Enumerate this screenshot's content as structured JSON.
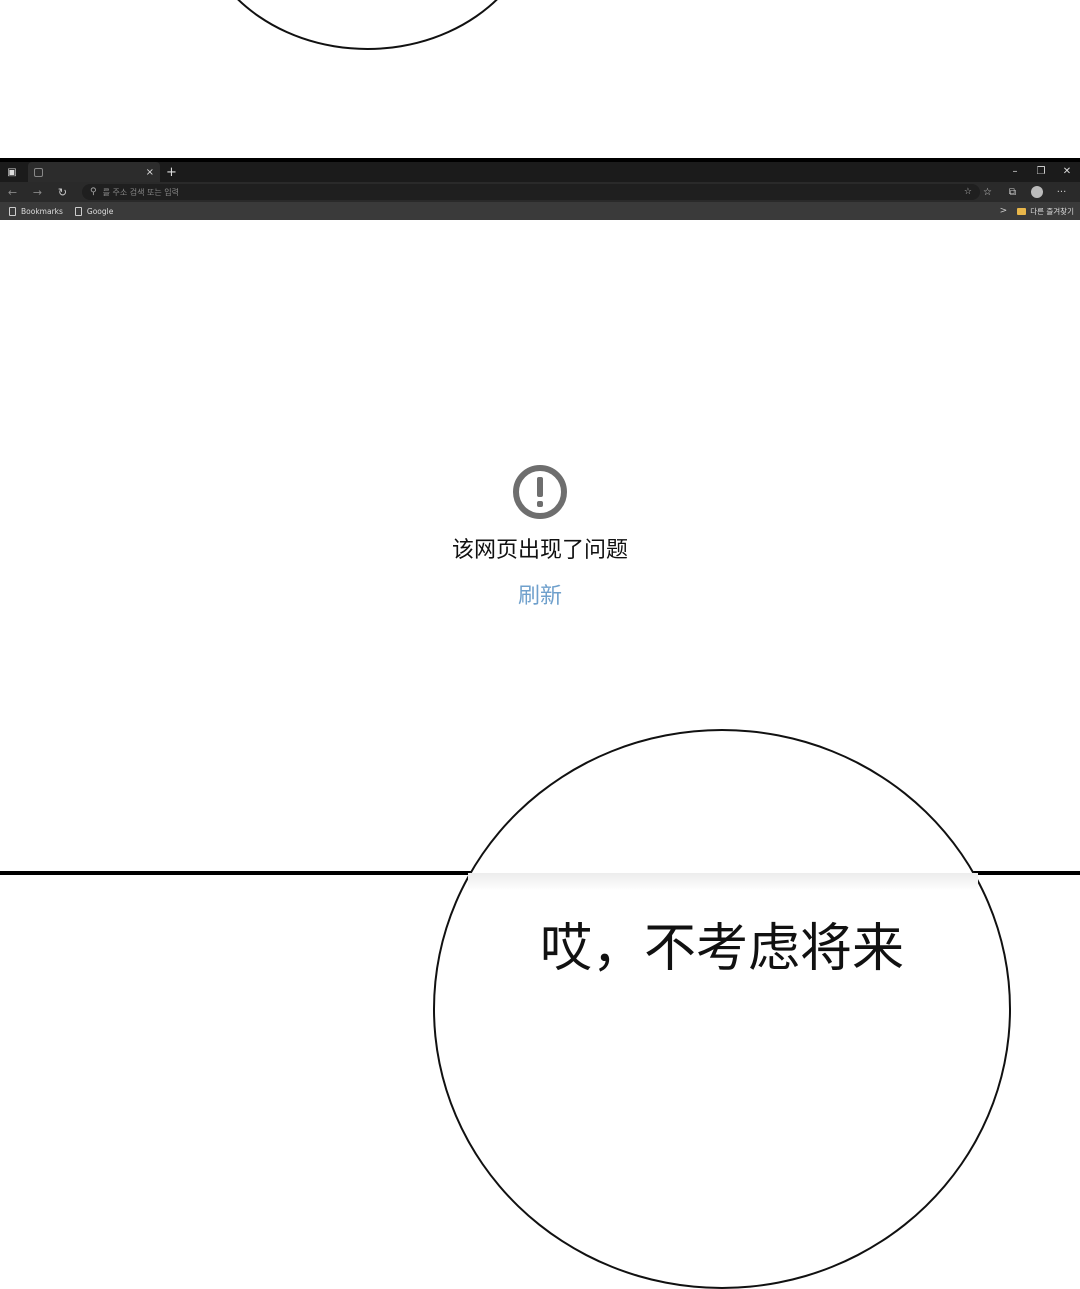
{
  "browser": {
    "tab": {
      "close_icon": "×"
    },
    "new_tab_icon": "+",
    "window_controls": {
      "minimize": "–",
      "restore": "❐",
      "close": "✕"
    },
    "nav": {
      "back": "←",
      "forward": "→",
      "reload": "↻"
    },
    "address_bar": {
      "placeholder": "를 주소 검색 또는 입력",
      "value": ""
    },
    "bookmarks": [
      {
        "label": "Bookmarks"
      },
      {
        "label": "Google"
      }
    ],
    "other_favorites": "다른 즐겨찾기",
    "more_menu": "···"
  },
  "error_page": {
    "message": "该网页出现了问题",
    "refresh_label": "刷新",
    "accent_color": "#6fa0cc"
  },
  "comic": {
    "bubble_lines": [
      "哎，不考虑将来"
    ]
  }
}
